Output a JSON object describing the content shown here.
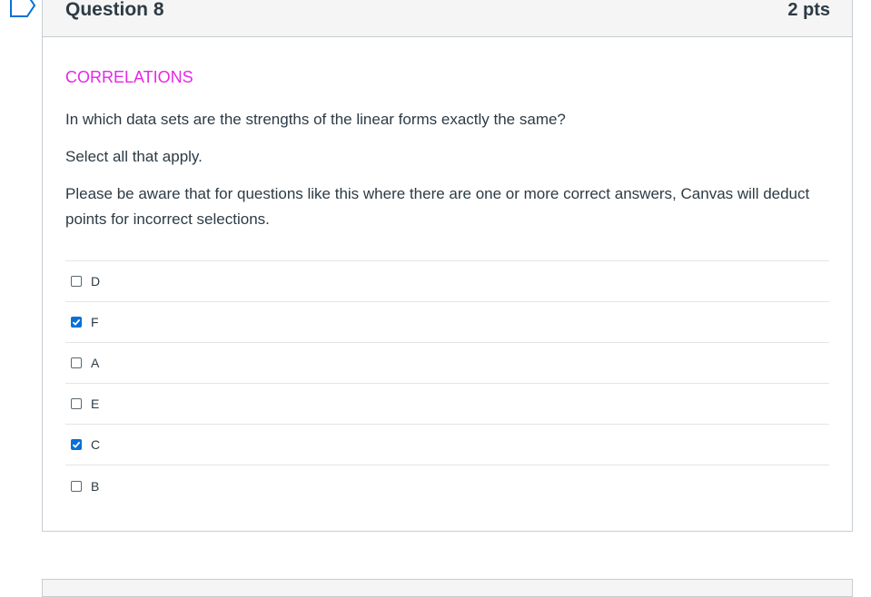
{
  "question": {
    "title": "Question 8",
    "points": "2 pts",
    "topic": "CORRELATIONS",
    "prompt": "In which data sets are the strengths of the linear forms exactly the same?",
    "instruction": "Select all that apply.",
    "warning": "Please be aware that for questions like this where there are one or more correct answers, Canvas will deduct points for incorrect selections.",
    "answers": [
      {
        "label": "D",
        "checked": false
      },
      {
        "label": "F",
        "checked": true
      },
      {
        "label": "A",
        "checked": false
      },
      {
        "label": "E",
        "checked": false
      },
      {
        "label": "C",
        "checked": true
      },
      {
        "label": "B",
        "checked": false
      }
    ]
  },
  "colors": {
    "topic": "#e628e6",
    "checkbox_checked": "#0770d8",
    "flag_outline": "#0770d8"
  },
  "icons": {
    "flag": "flag-question-icon",
    "check": "checkmark-icon"
  }
}
